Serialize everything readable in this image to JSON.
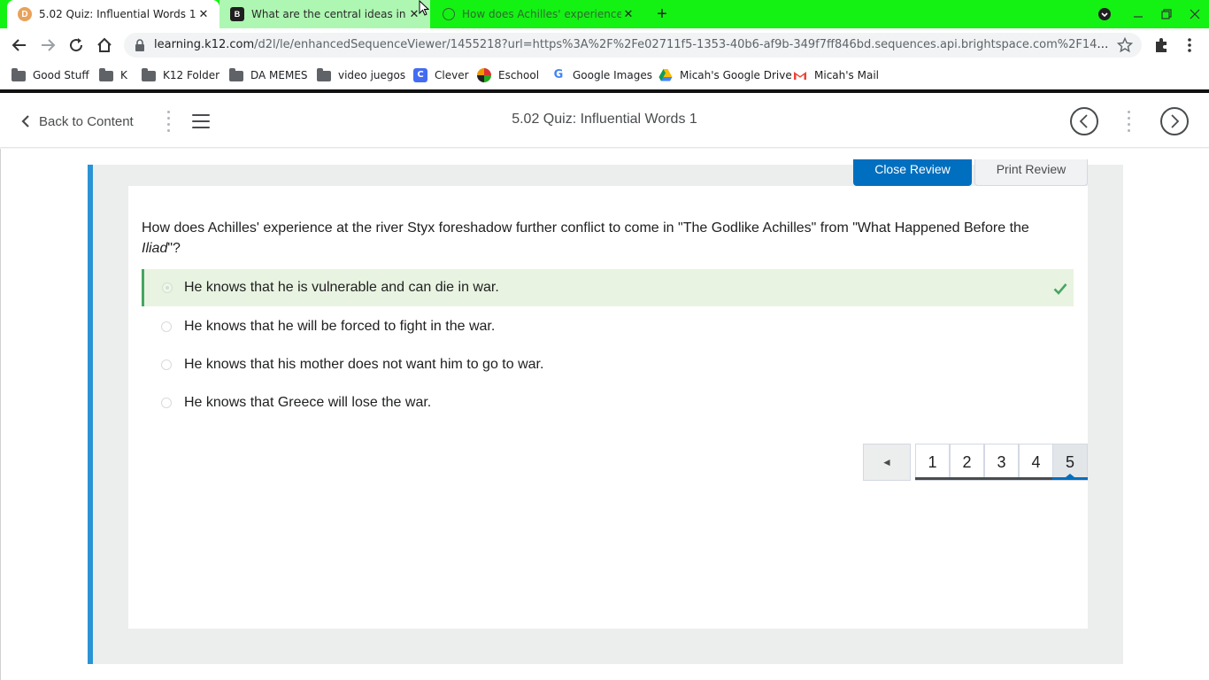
{
  "browser": {
    "tabs": [
      {
        "title": "5.02 Quiz: Influential Words 1",
        "favicon": "d2l-icon",
        "active": true
      },
      {
        "title": "What are the central ideas in \"Ho",
        "favicon": "brainly-icon",
        "active": false
      },
      {
        "title": "How does Achilles' experience at",
        "favicon": "globe-icon",
        "active": false
      }
    ],
    "url_host": "learning.k12.com",
    "url_path": "/d2l/le/enhancedSequenceViewer/1455218?url=https%3A%2F%2Fe02711f5-1353-40b6-af9b-349f7ff846bd.sequences.api.brightspace.com%2F1455218...",
    "bookmarks": [
      {
        "label": "Good Stuff",
        "icon": "folder-icon"
      },
      {
        "label": "K",
        "icon": "folder-icon"
      },
      {
        "label": "K12 Folder",
        "icon": "folder-icon"
      },
      {
        "label": "DA MEMES",
        "icon": "folder-icon"
      },
      {
        "label": "video juegos",
        "icon": "folder-icon"
      },
      {
        "label": "Clever",
        "icon": "clever-icon"
      },
      {
        "label": "Eschool",
        "icon": "eschool-icon"
      },
      {
        "label": "Google Images",
        "icon": "google-icon"
      },
      {
        "label": "Micah's Google Drive",
        "icon": "drive-icon"
      },
      {
        "label": "Micah's Mail",
        "icon": "gmail-icon"
      }
    ],
    "colors": {
      "tab_strip": "#14f214"
    }
  },
  "header": {
    "back_label": "Back to Content",
    "title": "5.02 Quiz: Influential Words 1"
  },
  "review": {
    "close_label": "Close Review",
    "print_label": "Print Review"
  },
  "question": {
    "text_before": "How does Achilles' experience at the river Styx foreshadow further conflict to come in \"The Godlike Achilles\" from \"What Happened Before the ",
    "text_italic": "Iliad",
    "text_after": "\"?",
    "answers": [
      {
        "text": "He knows that he is vulnerable and can die in war.",
        "selected": true,
        "correct": true
      },
      {
        "text": "He knows that he will be forced to fight in the war.",
        "selected": false,
        "correct": false
      },
      {
        "text": "He knows that his mother does not want him to go to war.",
        "selected": false,
        "correct": false
      },
      {
        "text": "He knows that Greece will lose the war.",
        "selected": false,
        "correct": false
      }
    ]
  },
  "pagination": {
    "prev_symbol": "◄",
    "pages": [
      "1",
      "2",
      "3",
      "4",
      "5"
    ],
    "current": "5"
  },
  "colors": {
    "accent": "#006fbf",
    "panel_accent": "#2b93d4",
    "correct_bg": "#e8f3e1",
    "correct_check": "#46a661"
  }
}
